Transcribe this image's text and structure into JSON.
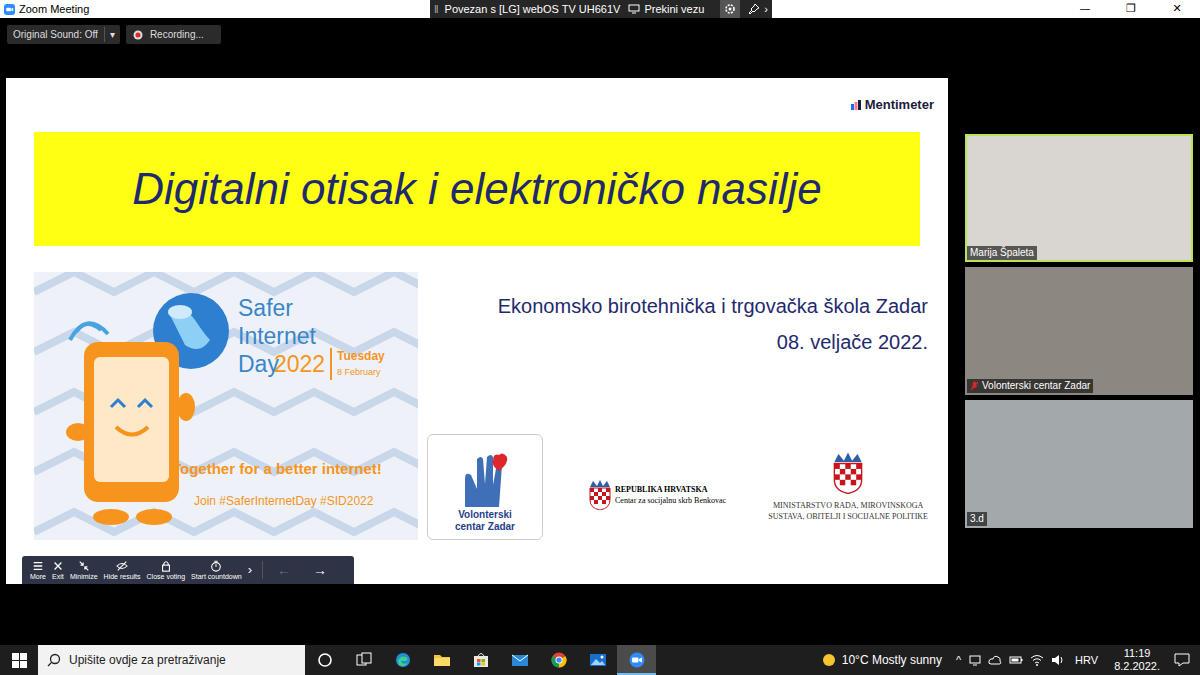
{
  "window": {
    "title": "Zoom Meeting",
    "controls": [
      "—",
      "❐",
      "✕"
    ]
  },
  "share_bar": {
    "handle": "‖",
    "status": "Povezan s [LG] webOS TV UH661V",
    "disconnect": "Prekini vezu",
    "more": "›"
  },
  "toolbar": {
    "original_sound": "Original Sound: Off",
    "dropdown": "▾",
    "recording": "Recording..."
  },
  "slide": {
    "brand": "Mentimeter",
    "title": "Digitalni otisak i elektroničko nasilje",
    "school": "Ekonomsko birotehnička i trgovačka škola Zadar",
    "date": "08. veljače 2022.",
    "banner": {
      "title": "Safer Internet Day",
      "year": "2022",
      "weekday": "Tuesday",
      "day": "8 February",
      "slogan": "Together for a better internet!",
      "hashtags": "Join #SaferInternetDay #SID2022"
    },
    "volunteer_logo": [
      "Volonterski",
      "centar Zadar"
    ],
    "centre_logo": [
      "REPUBLIKA HRVATSKA",
      "Centar za socijalnu skrb Benkovac"
    ],
    "ministry_logo": [
      "MINISTARSTVO RADA, MIROVINSKOGA",
      "SUSTAVA, OBITELJI I SOCIJALNE POLITIKE"
    ]
  },
  "presenter_bar": {
    "controls": [
      {
        "label": "More",
        "kind": "more"
      },
      {
        "label": "Exit",
        "kind": "exit"
      },
      {
        "label": "Minimize",
        "kind": "minimize"
      },
      {
        "label": "Hide results",
        "kind": "hide"
      },
      {
        "label": "Close voting",
        "kind": "lock"
      },
      {
        "label": "Start countdown",
        "kind": "timer"
      }
    ],
    "expand": "›",
    "nav": [
      {
        "label": "←",
        "disabled": true
      },
      {
        "label": "→",
        "disabled": false
      }
    ]
  },
  "participants": [
    {
      "name": "Marija Špaleta",
      "muted": false,
      "speaking": true
    },
    {
      "name": "Volonterski centar Zadar",
      "muted": true,
      "speaking": false
    },
    {
      "name": "3.d",
      "muted": false,
      "speaking": false
    }
  ],
  "taskbar": {
    "search": {
      "placeholder": "Upišite ovdje za pretraživanje"
    },
    "apps": [
      {
        "kind": "cortana",
        "active": false
      },
      {
        "kind": "taskview",
        "active": false
      },
      {
        "kind": "edge",
        "active": false
      },
      {
        "kind": "explorer",
        "active": false
      },
      {
        "kind": "store",
        "active": false
      },
      {
        "kind": "mail",
        "active": false
      },
      {
        "kind": "chrome",
        "active": false
      },
      {
        "kind": "photos",
        "active": false
      },
      {
        "kind": "zoom",
        "active": true
      }
    ],
    "weather": "10°C Mostly sunny",
    "tray_chevron": "^",
    "language": "HRV",
    "time": "11:19",
    "date": "8.2.2022."
  }
}
